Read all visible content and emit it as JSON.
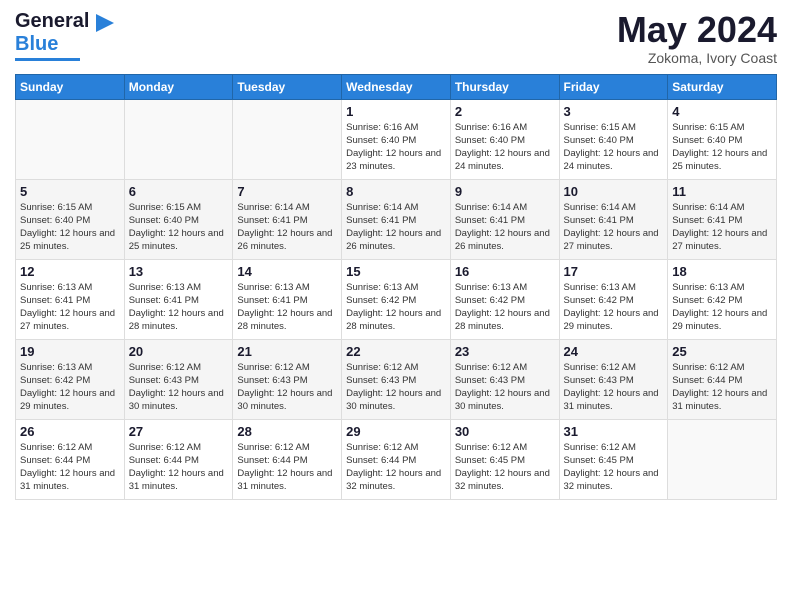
{
  "header": {
    "logo_general": "General",
    "logo_blue": "Blue",
    "month_title": "May 2024",
    "location": "Zokoma, Ivory Coast"
  },
  "days_of_week": [
    "Sunday",
    "Monday",
    "Tuesday",
    "Wednesday",
    "Thursday",
    "Friday",
    "Saturday"
  ],
  "weeks": [
    [
      {
        "day": "",
        "sunrise": "",
        "sunset": "",
        "daylight": ""
      },
      {
        "day": "",
        "sunrise": "",
        "sunset": "",
        "daylight": ""
      },
      {
        "day": "",
        "sunrise": "",
        "sunset": "",
        "daylight": ""
      },
      {
        "day": "1",
        "sunrise": "Sunrise: 6:16 AM",
        "sunset": "Sunset: 6:40 PM",
        "daylight": "Daylight: 12 hours and 23 minutes."
      },
      {
        "day": "2",
        "sunrise": "Sunrise: 6:16 AM",
        "sunset": "Sunset: 6:40 PM",
        "daylight": "Daylight: 12 hours and 24 minutes."
      },
      {
        "day": "3",
        "sunrise": "Sunrise: 6:15 AM",
        "sunset": "Sunset: 6:40 PM",
        "daylight": "Daylight: 12 hours and 24 minutes."
      },
      {
        "day": "4",
        "sunrise": "Sunrise: 6:15 AM",
        "sunset": "Sunset: 6:40 PM",
        "daylight": "Daylight: 12 hours and 25 minutes."
      }
    ],
    [
      {
        "day": "5",
        "sunrise": "Sunrise: 6:15 AM",
        "sunset": "Sunset: 6:40 PM",
        "daylight": "Daylight: 12 hours and 25 minutes."
      },
      {
        "day": "6",
        "sunrise": "Sunrise: 6:15 AM",
        "sunset": "Sunset: 6:40 PM",
        "daylight": "Daylight: 12 hours and 25 minutes."
      },
      {
        "day": "7",
        "sunrise": "Sunrise: 6:14 AM",
        "sunset": "Sunset: 6:41 PM",
        "daylight": "Daylight: 12 hours and 26 minutes."
      },
      {
        "day": "8",
        "sunrise": "Sunrise: 6:14 AM",
        "sunset": "Sunset: 6:41 PM",
        "daylight": "Daylight: 12 hours and 26 minutes."
      },
      {
        "day": "9",
        "sunrise": "Sunrise: 6:14 AM",
        "sunset": "Sunset: 6:41 PM",
        "daylight": "Daylight: 12 hours and 26 minutes."
      },
      {
        "day": "10",
        "sunrise": "Sunrise: 6:14 AM",
        "sunset": "Sunset: 6:41 PM",
        "daylight": "Daylight: 12 hours and 27 minutes."
      },
      {
        "day": "11",
        "sunrise": "Sunrise: 6:14 AM",
        "sunset": "Sunset: 6:41 PM",
        "daylight": "Daylight: 12 hours and 27 minutes."
      }
    ],
    [
      {
        "day": "12",
        "sunrise": "Sunrise: 6:13 AM",
        "sunset": "Sunset: 6:41 PM",
        "daylight": "Daylight: 12 hours and 27 minutes."
      },
      {
        "day": "13",
        "sunrise": "Sunrise: 6:13 AM",
        "sunset": "Sunset: 6:41 PM",
        "daylight": "Daylight: 12 hours and 28 minutes."
      },
      {
        "day": "14",
        "sunrise": "Sunrise: 6:13 AM",
        "sunset": "Sunset: 6:41 PM",
        "daylight": "Daylight: 12 hours and 28 minutes."
      },
      {
        "day": "15",
        "sunrise": "Sunrise: 6:13 AM",
        "sunset": "Sunset: 6:42 PM",
        "daylight": "Daylight: 12 hours and 28 minutes."
      },
      {
        "day": "16",
        "sunrise": "Sunrise: 6:13 AM",
        "sunset": "Sunset: 6:42 PM",
        "daylight": "Daylight: 12 hours and 28 minutes."
      },
      {
        "day": "17",
        "sunrise": "Sunrise: 6:13 AM",
        "sunset": "Sunset: 6:42 PM",
        "daylight": "Daylight: 12 hours and 29 minutes."
      },
      {
        "day": "18",
        "sunrise": "Sunrise: 6:13 AM",
        "sunset": "Sunset: 6:42 PM",
        "daylight": "Daylight: 12 hours and 29 minutes."
      }
    ],
    [
      {
        "day": "19",
        "sunrise": "Sunrise: 6:13 AM",
        "sunset": "Sunset: 6:42 PM",
        "daylight": "Daylight: 12 hours and 29 minutes."
      },
      {
        "day": "20",
        "sunrise": "Sunrise: 6:12 AM",
        "sunset": "Sunset: 6:43 PM",
        "daylight": "Daylight: 12 hours and 30 minutes."
      },
      {
        "day": "21",
        "sunrise": "Sunrise: 6:12 AM",
        "sunset": "Sunset: 6:43 PM",
        "daylight": "Daylight: 12 hours and 30 minutes."
      },
      {
        "day": "22",
        "sunrise": "Sunrise: 6:12 AM",
        "sunset": "Sunset: 6:43 PM",
        "daylight": "Daylight: 12 hours and 30 minutes."
      },
      {
        "day": "23",
        "sunrise": "Sunrise: 6:12 AM",
        "sunset": "Sunset: 6:43 PM",
        "daylight": "Daylight: 12 hours and 30 minutes."
      },
      {
        "day": "24",
        "sunrise": "Sunrise: 6:12 AM",
        "sunset": "Sunset: 6:43 PM",
        "daylight": "Daylight: 12 hours and 31 minutes."
      },
      {
        "day": "25",
        "sunrise": "Sunrise: 6:12 AM",
        "sunset": "Sunset: 6:44 PM",
        "daylight": "Daylight: 12 hours and 31 minutes."
      }
    ],
    [
      {
        "day": "26",
        "sunrise": "Sunrise: 6:12 AM",
        "sunset": "Sunset: 6:44 PM",
        "daylight": "Daylight: 12 hours and 31 minutes."
      },
      {
        "day": "27",
        "sunrise": "Sunrise: 6:12 AM",
        "sunset": "Sunset: 6:44 PM",
        "daylight": "Daylight: 12 hours and 31 minutes."
      },
      {
        "day": "28",
        "sunrise": "Sunrise: 6:12 AM",
        "sunset": "Sunset: 6:44 PM",
        "daylight": "Daylight: 12 hours and 31 minutes."
      },
      {
        "day": "29",
        "sunrise": "Sunrise: 6:12 AM",
        "sunset": "Sunset: 6:44 PM",
        "daylight": "Daylight: 12 hours and 32 minutes."
      },
      {
        "day": "30",
        "sunrise": "Sunrise: 6:12 AM",
        "sunset": "Sunset: 6:45 PM",
        "daylight": "Daylight: 12 hours and 32 minutes."
      },
      {
        "day": "31",
        "sunrise": "Sunrise: 6:12 AM",
        "sunset": "Sunset: 6:45 PM",
        "daylight": "Daylight: 12 hours and 32 minutes."
      },
      {
        "day": "",
        "sunrise": "",
        "sunset": "",
        "daylight": ""
      }
    ]
  ]
}
